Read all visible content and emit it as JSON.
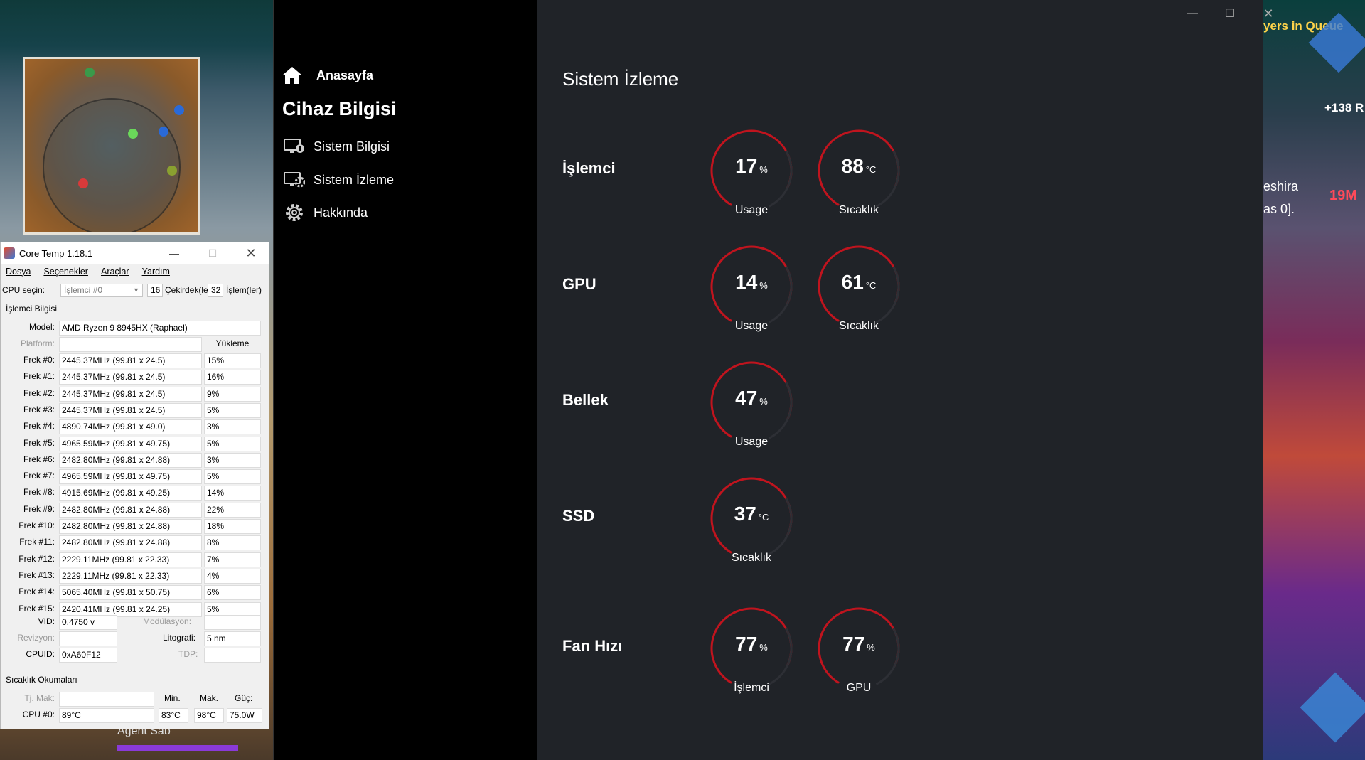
{
  "game": {
    "queue_text": "yers in Queue",
    "score_text": "+138 R",
    "name_text": "eshira",
    "name_text2": "as 0].",
    "distance_text": "19M",
    "agent_text": "Agent Sab"
  },
  "coretemp": {
    "title": "Core Temp 1.18.1",
    "menu": [
      "Dosya",
      "Seçenekler",
      "Araçlar",
      "Yardım"
    ],
    "cpu_select_label": "CPU seçin:",
    "cpu_select_value": "İşlemci #0",
    "cores_count": "16",
    "cores_label": "Çekirdek(ler)",
    "threads_count": "32",
    "threads_label": "İşlem(ler)",
    "group_title": "İşlemci Bilgisi",
    "model_label": "Model:",
    "model_value": "AMD Ryzen 9 8945HX (Raphael)",
    "platform_label": "Platform:",
    "load_header": "Yükleme",
    "frequencies": [
      {
        "label": "Frek #0:",
        "value": "2445.37MHz (99.81 x 24.5)",
        "load": "15%"
      },
      {
        "label": "Frek #1:",
        "value": "2445.37MHz (99.81 x 24.5)",
        "load": "16%"
      },
      {
        "label": "Frek #2:",
        "value": "2445.37MHz (99.81 x 24.5)",
        "load": "9%"
      },
      {
        "label": "Frek #3:",
        "value": "2445.37MHz (99.81 x 24.5)",
        "load": "5%"
      },
      {
        "label": "Frek #4:",
        "value": "4890.74MHz (99.81 x 49.0)",
        "load": "3%"
      },
      {
        "label": "Frek #5:",
        "value": "4965.59MHz (99.81 x 49.75)",
        "load": "5%"
      },
      {
        "label": "Frek #6:",
        "value": "2482.80MHz (99.81 x 24.88)",
        "load": "3%"
      },
      {
        "label": "Frek #7:",
        "value": "4965.59MHz (99.81 x 49.75)",
        "load": "5%"
      },
      {
        "label": "Frek #8:",
        "value": "4915.69MHz (99.81 x 49.25)",
        "load": "14%"
      },
      {
        "label": "Frek #9:",
        "value": "2482.80MHz (99.81 x 24.88)",
        "load": "22%"
      },
      {
        "label": "Frek #10:",
        "value": "2482.80MHz (99.81 x 24.88)",
        "load": "18%"
      },
      {
        "label": "Frek #11:",
        "value": "2482.80MHz (99.81 x 24.88)",
        "load": "8%"
      },
      {
        "label": "Frek #12:",
        "value": "2229.11MHz (99.81 x 22.33)",
        "load": "7%"
      },
      {
        "label": "Frek #13:",
        "value": "2229.11MHz (99.81 x 22.33)",
        "load": "4%"
      },
      {
        "label": "Frek #14:",
        "value": "5065.40MHz (99.81 x 50.75)",
        "load": "6%"
      },
      {
        "label": "Frek #15:",
        "value": "2420.41MHz (99.81 x 24.25)",
        "load": "5%"
      }
    ],
    "vid_label": "VID:",
    "vid_value": "0.4750 v",
    "modulation_label": "Modülasyon:",
    "revision_label": "Revizyon:",
    "litho_label": "Litografi:",
    "litho_value": "5 nm",
    "cpuid_label": "CPUID:",
    "cpuid_value": "0xA60F12",
    "tdp_label": "TDP:",
    "temps_title": "Sıcaklık Okumaları",
    "tj_label": "Tj. Mak:",
    "min_header": "Min.",
    "max_header": "Mak.",
    "power_header": "Güç:",
    "cpu0_label": "CPU #0:",
    "cpu0_temp": "89°C",
    "cpu0_min": "83°C",
    "cpu0_max": "98°C",
    "cpu0_power": "75.0W"
  },
  "app": {
    "home_label": "Anasayfa",
    "section_title": "Cihaz Bilgisi",
    "nav": [
      {
        "label": "Sistem Bilgisi",
        "icon": "monitor-info-icon"
      },
      {
        "label": "Sistem İzleme",
        "icon": "monitor-gear-icon"
      },
      {
        "label": "Hakkında",
        "icon": "gear-icon"
      }
    ],
    "page_title": "Sistem İzleme",
    "accent_color": "#c0141e",
    "metrics": [
      {
        "name": "İşlemci",
        "gauges": [
          {
            "value": "17",
            "unit": "%",
            "caption": "Usage"
          },
          {
            "value": "88",
            "unit": "°C",
            "caption": "Sıcaklık"
          }
        ]
      },
      {
        "name": "GPU",
        "gauges": [
          {
            "value": "14",
            "unit": "%",
            "caption": "Usage"
          },
          {
            "value": "61",
            "unit": "°C",
            "caption": "Sıcaklık"
          }
        ]
      },
      {
        "name": "Bellek",
        "gauges": [
          {
            "value": "47",
            "unit": "%",
            "caption": "Usage"
          }
        ]
      },
      {
        "name": "SSD",
        "gauges": [
          {
            "value": "37",
            "unit": "°C",
            "caption": "Sıcaklık"
          }
        ]
      },
      {
        "name": "Fan Hızı",
        "gauges": [
          {
            "value": "77",
            "unit": "%",
            "caption": "İşlemci"
          },
          {
            "value": "77",
            "unit": "%",
            "caption": "GPU"
          }
        ]
      }
    ]
  }
}
